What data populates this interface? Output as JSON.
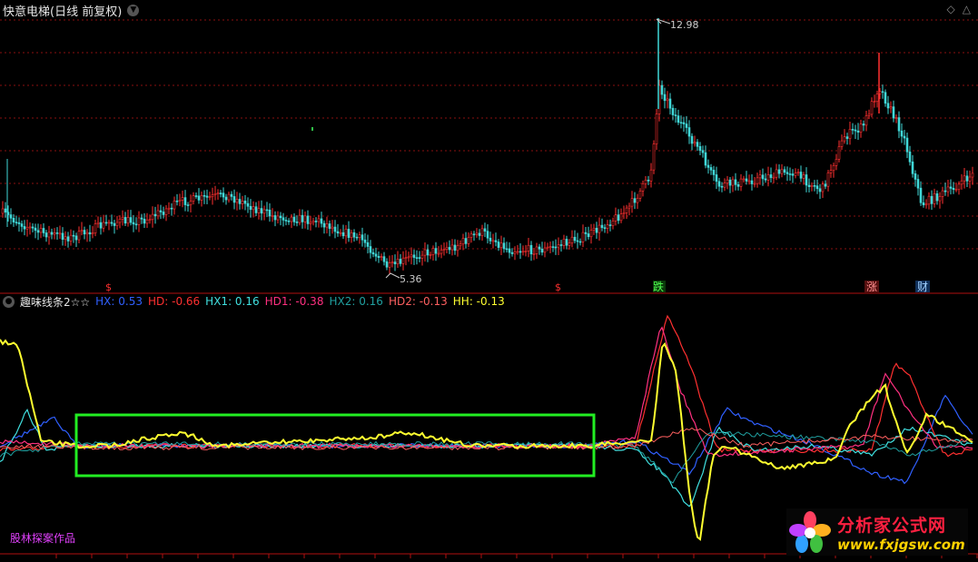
{
  "main_panel": {
    "title": "快意电梯(日线 前复权)",
    "high_label": "12.98",
    "low_label": "5.36",
    "signals": [
      {
        "text": "$",
        "color": "#ff3030"
      },
      {
        "text": "$",
        "color": "#ff3030"
      },
      {
        "text": "跌",
        "color": "#50ff50"
      },
      {
        "text": "涨",
        "color": "#ff4040"
      },
      {
        "text": "财",
        "color": "#4fa8ff"
      }
    ]
  },
  "indicator_panel": {
    "name": "趣味线条2☆☆",
    "values": [
      {
        "label": "HX",
        "value": "0.53",
        "color": "#3060ff"
      },
      {
        "label": "HD",
        "value": "-0.66",
        "color": "#ff3030"
      },
      {
        "label": "HX1",
        "value": "0.16",
        "color": "#40e0e0"
      },
      {
        "label": "HD1",
        "value": "-0.38",
        "color": "#ff3080"
      },
      {
        "label": "HX2",
        "value": "0.16",
        "color": "#20a0a0"
      },
      {
        "label": "HD2",
        "value": "-0.13",
        "color": "#ff6060"
      },
      {
        "label": "HH",
        "value": "-0.13",
        "color": "#ffff30"
      }
    ]
  },
  "signature": "股林探案作品",
  "watermark": {
    "title": "分析家公式网",
    "url": "www.fxjgsw.com"
  },
  "colors": {
    "up": "#ff3030",
    "down": "#40d8d8",
    "grid": "#8a1010",
    "box": "#22ee22"
  }
}
